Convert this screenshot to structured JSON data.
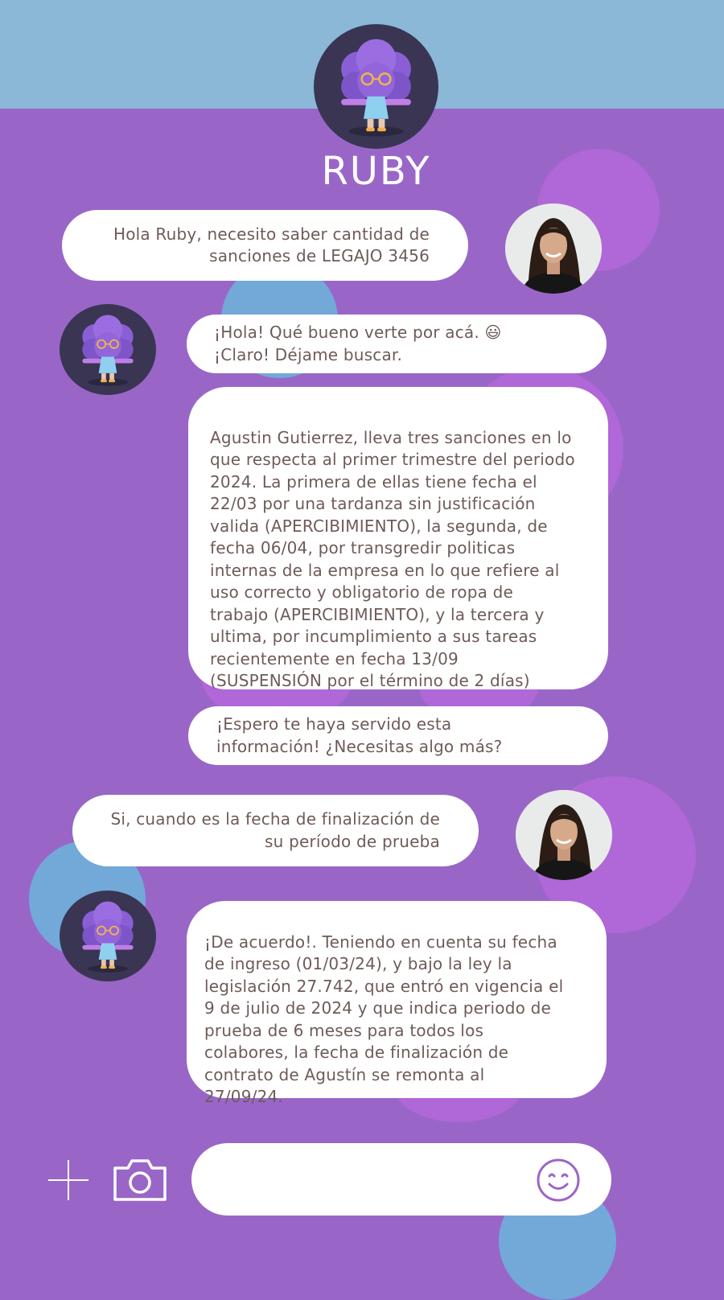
{
  "header": {
    "title": "RUBY"
  },
  "messages": [
    {
      "sender": "user",
      "text": "Hola Ruby, necesito saber cantidad de\nsanciones de LEGAJO 3456"
    },
    {
      "sender": "bot",
      "text": "¡Hola! Qué bueno verte por acá. 😃\n¡Claro! Déjame buscar."
    },
    {
      "sender": "bot",
      "text": "Agustin Gutierrez, lleva tres sanciones en lo\nque respecta al primer trimestre del periodo\n2024. La primera de ellas tiene fecha el\n22/03 por una tardanza sin justificación\nvalida (APERCIBIMIENTO), la segunda, de\nfecha 06/04, por transgredir politicas\ninternas de la empresa en lo que refiere al\nuso correcto y obligatorio de ropa de\ntrabajo (APERCIBIMIENTO), y la tercera y\nultima, por incumplimiento a sus tareas\nrecientemente en fecha 13/09\n(SUSPENSIÓN por el término de 2 días)"
    },
    {
      "sender": "bot",
      "text": "¡Espero te haya servido esta\ninformación! ¿Necesitas algo más?"
    },
    {
      "sender": "user",
      "text": "Si, cuando es la fecha de finalización de\nsu período  de prueba"
    },
    {
      "sender": "bot",
      "text": "¡De acuerdo!. Teniendo en cuenta su fecha\nde ingreso (01/03/24), y bajo la ley la\nlegislación 27.742, que entró en vigencia el\n9 de julio de 2024 y que indica periodo de\nprueba de 6 meses para todos los\ncolabores, la fecha de finalización de\ncontrato de Agustín se remonta al\n27/09/24."
    }
  ],
  "composer": {
    "placeholder": "",
    "icons": [
      "plus-icon",
      "camera-icon",
      "smiley-icon"
    ]
  },
  "colors": {
    "background": "#9966c8",
    "header_band": "#8ab8d6",
    "bubble": "#ffffff",
    "text": "#6e5b58",
    "decor_violet": "#b067d8",
    "decor_blue": "#72a9d9"
  }
}
